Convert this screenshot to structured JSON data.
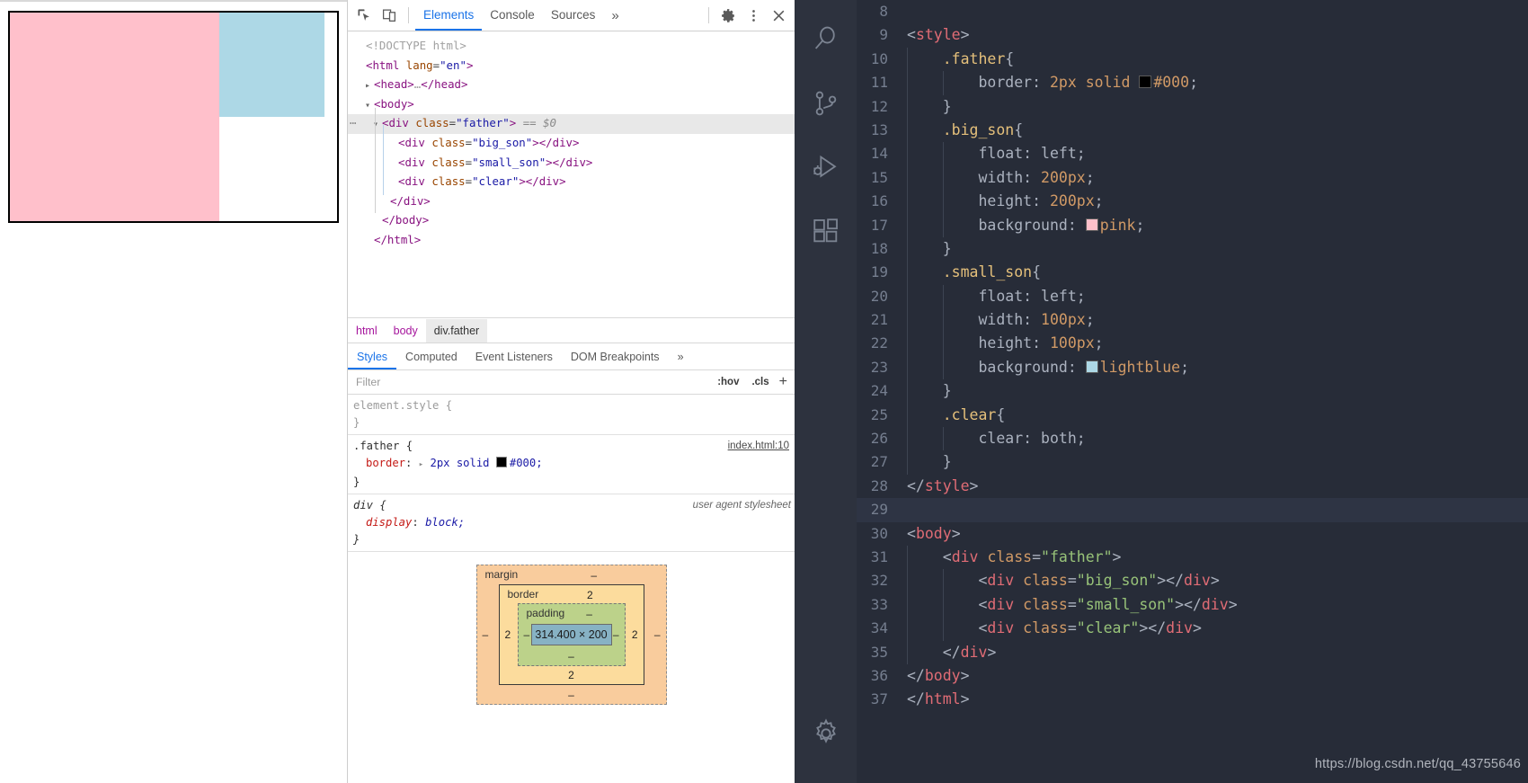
{
  "preview": {
    "father_border_color": "#000000",
    "big_son_color": "#ffc0cb",
    "small_son_color": "#add8e6"
  },
  "devtools": {
    "toolbar": {
      "inspect_icon": "inspect-element-icon",
      "device_icon": "device-toolbar-icon",
      "tabs": [
        {
          "label": "Elements",
          "active": true
        },
        {
          "label": "Console",
          "active": false
        },
        {
          "label": "Sources",
          "active": false
        }
      ],
      "more_tabs": "»",
      "settings_icon": "gear-icon",
      "menu_icon": "kebab-menu-icon",
      "close_icon": "close-icon"
    },
    "dom_tree": [
      {
        "indent": 0,
        "tri": "",
        "html": "<span class=\"pk\">&lt;!DOCTYPE html&gt;</span>",
        "selected": false,
        "dots": false
      },
      {
        "indent": 0,
        "tri": "",
        "html": "<span class=\"tg\">&lt;html</span> <span class=\"at\">lang</span>=<span class=\"av\">\"en\"</span><span class=\"tg\">&gt;</span>",
        "selected": false,
        "dots": false
      },
      {
        "indent": 1,
        "tri": "▸",
        "html": "<span class=\"tg\">&lt;head&gt;</span><span class=\"pk\">…</span><span class=\"tg\">&lt;/head&gt;</span>",
        "selected": false,
        "dots": false
      },
      {
        "indent": 1,
        "tri": "▾",
        "html": "<span class=\"tg\">&lt;body&gt;</span>",
        "selected": false,
        "dots": false
      },
      {
        "indent": 2,
        "tri": "▾",
        "html": "<span class=\"tg\">&lt;div</span> <span class=\"at\">class</span>=<span class=\"av\">\"father\"</span><span class=\"tg\">&gt;</span> <span class=\"dollar\">== $0</span>",
        "selected": true,
        "dots": true
      },
      {
        "indent": 4,
        "tri": "",
        "html": "<span class=\"tg\">&lt;div</span> <span class=\"at\">class</span>=<span class=\"av\">\"big_son\"</span><span class=\"tg\">&gt;&lt;/div&gt;</span>",
        "selected": false,
        "dots": false
      },
      {
        "indent": 4,
        "tri": "",
        "html": "<span class=\"tg\">&lt;div</span> <span class=\"at\">class</span>=<span class=\"av\">\"small_son\"</span><span class=\"tg\">&gt;&lt;/div&gt;</span>",
        "selected": false,
        "dots": false
      },
      {
        "indent": 4,
        "tri": "",
        "html": "<span class=\"tg\">&lt;div</span> <span class=\"at\">class</span>=<span class=\"av\">\"clear\"</span><span class=\"tg\">&gt;&lt;/div&gt;</span>",
        "selected": false,
        "dots": false
      },
      {
        "indent": 3,
        "tri": "",
        "html": "<span class=\"tg\">&lt;/div&gt;</span>",
        "selected": false,
        "dots": false
      },
      {
        "indent": 2,
        "tri": "",
        "html": "<span class=\"tg\">&lt;/body&gt;</span>",
        "selected": false,
        "dots": false
      },
      {
        "indent": 1,
        "tri": "",
        "html": "<span class=\"tg\">&lt;/html&gt;</span>",
        "selected": false,
        "dots": false
      }
    ],
    "breadcrumb": [
      {
        "label": "html",
        "selected": false
      },
      {
        "label": "body",
        "selected": false
      },
      {
        "label": "div.father",
        "selected": true
      }
    ],
    "style_tabs": [
      {
        "label": "Styles",
        "active": true
      },
      {
        "label": "Computed",
        "active": false
      },
      {
        "label": "Event Listeners",
        "active": false
      },
      {
        "label": "DOM Breakpoints",
        "active": false
      }
    ],
    "style_tabs_more": "»",
    "filter": {
      "placeholder": "Filter",
      "value": "",
      "hov_label": ":hov",
      "cls_label": ".cls",
      "plus_label": "+"
    },
    "rules": [
      {
        "selector": "element.style {",
        "close": "}",
        "source": "",
        "greyed": true,
        "declarations": []
      },
      {
        "selector": ".father {",
        "close": "}",
        "source": "index.html:10",
        "greyed": false,
        "declarations": [
          {
            "prop": "border",
            "arrow": "▸",
            "value": "2px solid",
            "swatch": "#000000",
            "value2": "#000;"
          }
        ]
      },
      {
        "selector": "div {",
        "close": "}",
        "source": "",
        "user_agent": "user agent stylesheet",
        "greyed": false,
        "italic": true,
        "declarations": [
          {
            "prop": "display",
            "arrow": "",
            "value": "block;",
            "swatch": "",
            "value2": ""
          }
        ]
      }
    ],
    "box_model": {
      "margin_label": "margin",
      "margin_top": "–",
      "margin_right": "–",
      "margin_bottom": "–",
      "margin_left": "–",
      "border_label": "border",
      "border_top": "2",
      "border_right": "2",
      "border_bottom": "2",
      "border_left": "2",
      "padding_label": "padding",
      "padding_top": "–",
      "padding_right": "–",
      "padding_bottom": "–",
      "padding_left": "–",
      "content_size": "314.400 × 200"
    }
  },
  "vscode": {
    "activity_icons": [
      "search-icon",
      "source-control-icon",
      "run-and-debug-icon",
      "extensions-icon",
      "settings-gear-icon"
    ],
    "code_lines": [
      {
        "no": "8",
        "highlight": false,
        "guides": 0,
        "html": ""
      },
      {
        "no": "9",
        "highlight": false,
        "guides": 0,
        "html": "<span class=\"t-punct\">&lt;</span><span class=\"t-tag\">style</span><span class=\"t-punct\">&gt;</span>"
      },
      {
        "no": "10",
        "highlight": false,
        "guides": 1,
        "html": "    <span class=\"t-sel\">.father</span><span class=\"t-brace\">{</span>"
      },
      {
        "no": "11",
        "highlight": false,
        "guides": 2,
        "html": "        <span class=\"t-prop\">border</span><span class=\"t-punct\">:</span> <span class=\"t-num\">2px solid </span><span class=\"cswatch\" style=\"background:#000000\"></span><span class=\"t-num\">#000</span><span class=\"t-punct\">;</span>"
      },
      {
        "no": "12",
        "highlight": false,
        "guides": 1,
        "html": "    <span class=\"t-brace\">}</span>"
      },
      {
        "no": "13",
        "highlight": false,
        "guides": 1,
        "html": "    <span class=\"t-sel\">.big_son</span><span class=\"t-brace\">{</span>"
      },
      {
        "no": "14",
        "highlight": false,
        "guides": 2,
        "html": "        <span class=\"t-prop\">float</span><span class=\"t-punct\">:</span> <span class=\"t-plain\">left</span><span class=\"t-punct\">;</span>"
      },
      {
        "no": "15",
        "highlight": false,
        "guides": 2,
        "html": "        <span class=\"t-prop\">width</span><span class=\"t-punct\">:</span> <span class=\"t-num\">200px</span><span class=\"t-punct\">;</span>"
      },
      {
        "no": "16",
        "highlight": false,
        "guides": 2,
        "html": "        <span class=\"t-prop\">height</span><span class=\"t-punct\">:</span> <span class=\"t-num\">200px</span><span class=\"t-punct\">;</span>"
      },
      {
        "no": "17",
        "highlight": false,
        "guides": 2,
        "html": "        <span class=\"t-prop\">background</span><span class=\"t-punct\">:</span> <span class=\"cswatch\" style=\"background:#ffc0cb\"></span><span class=\"t-num\">pink</span><span class=\"t-punct\">;</span>"
      },
      {
        "no": "18",
        "highlight": false,
        "guides": 1,
        "html": "    <span class=\"t-brace\">}</span>"
      },
      {
        "no": "19",
        "highlight": false,
        "guides": 1,
        "html": "    <span class=\"t-sel\">.small_son</span><span class=\"t-brace\">{</span>"
      },
      {
        "no": "20",
        "highlight": false,
        "guides": 2,
        "html": "        <span class=\"t-prop\">float</span><span class=\"t-punct\">:</span> <span class=\"t-plain\">left</span><span class=\"t-punct\">;</span>"
      },
      {
        "no": "21",
        "highlight": false,
        "guides": 2,
        "html": "        <span class=\"t-prop\">width</span><span class=\"t-punct\">:</span> <span class=\"t-num\">100px</span><span class=\"t-punct\">;</span>"
      },
      {
        "no": "22",
        "highlight": false,
        "guides": 2,
        "html": "        <span class=\"t-prop\">height</span><span class=\"t-punct\">:</span> <span class=\"t-num\">100px</span><span class=\"t-punct\">;</span>"
      },
      {
        "no": "23",
        "highlight": false,
        "guides": 2,
        "html": "        <span class=\"t-prop\">background</span><span class=\"t-punct\">:</span> <span class=\"cswatch\" style=\"background:#add8e6\"></span><span class=\"t-num\">lightblue</span><span class=\"t-punct\">;</span>"
      },
      {
        "no": "24",
        "highlight": false,
        "guides": 1,
        "html": "    <span class=\"t-brace\">}</span>"
      },
      {
        "no": "25",
        "highlight": false,
        "guides": 1,
        "html": "    <span class=\"t-sel\">.clear</span><span class=\"t-brace\">{</span>"
      },
      {
        "no": "26",
        "highlight": false,
        "guides": 2,
        "html": "        <span class=\"t-prop\">clear</span><span class=\"t-punct\">:</span> <span class=\"t-plain\">both</span><span class=\"t-punct\">;</span>"
      },
      {
        "no": "27",
        "highlight": false,
        "guides": 1,
        "html": "    <span class=\"t-brace\">}</span>"
      },
      {
        "no": "28",
        "highlight": false,
        "guides": 0,
        "html": "<span class=\"t-punct\">&lt;/</span><span class=\"t-tag\">style</span><span class=\"t-punct\">&gt;</span>"
      },
      {
        "no": "29",
        "highlight": true,
        "guides": 0,
        "html": ""
      },
      {
        "no": "30",
        "highlight": false,
        "guides": 0,
        "html": "<span class=\"t-punct\">&lt;</span><span class=\"t-tag\">body</span><span class=\"t-punct\">&gt;</span>"
      },
      {
        "no": "31",
        "highlight": false,
        "guides": 1,
        "html": "    <span class=\"t-punct\">&lt;</span><span class=\"t-tag\">div</span> <span class=\"t-attr\">class</span><span class=\"t-punct\">=</span><span class=\"t-str\">\"father\"</span><span class=\"t-punct\">&gt;</span>"
      },
      {
        "no": "32",
        "highlight": false,
        "guides": 2,
        "html": "        <span class=\"t-punct\">&lt;</span><span class=\"t-tag\">div</span> <span class=\"t-attr\">class</span><span class=\"t-punct\">=</span><span class=\"t-str\">\"big_son\"</span><span class=\"t-punct\">&gt;&lt;/</span><span class=\"t-tag\">div</span><span class=\"t-punct\">&gt;</span>"
      },
      {
        "no": "33",
        "highlight": false,
        "guides": 2,
        "html": "        <span class=\"t-punct\">&lt;</span><span class=\"t-tag\">div</span> <span class=\"t-attr\">class</span><span class=\"t-punct\">=</span><span class=\"t-str\">\"small_son\"</span><span class=\"t-punct\">&gt;&lt;/</span><span class=\"t-tag\">div</span><span class=\"t-punct\">&gt;</span>"
      },
      {
        "no": "34",
        "highlight": false,
        "guides": 2,
        "html": "        <span class=\"t-punct\">&lt;</span><span class=\"t-tag\">div</span> <span class=\"t-attr\">class</span><span class=\"t-punct\">=</span><span class=\"t-str\">\"clear\"</span><span class=\"t-punct\">&gt;&lt;/</span><span class=\"t-tag\">div</span><span class=\"t-punct\">&gt;</span>"
      },
      {
        "no": "35",
        "highlight": false,
        "guides": 1,
        "html": "    <span class=\"t-punct\">&lt;/</span><span class=\"t-tag\">div</span><span class=\"t-punct\">&gt;</span>"
      },
      {
        "no": "36",
        "highlight": false,
        "guides": 0,
        "html": "<span class=\"t-punct\">&lt;/</span><span class=\"t-tag\">body</span><span class=\"t-punct\">&gt;</span>"
      },
      {
        "no": "37",
        "highlight": false,
        "guides": 0,
        "html": "<span class=\"t-punct\">&lt;/</span><span class=\"t-tag\">html</span><span class=\"t-punct\">&gt;</span>"
      }
    ],
    "watermark": "https://blog.csdn.net/qq_43755646"
  }
}
